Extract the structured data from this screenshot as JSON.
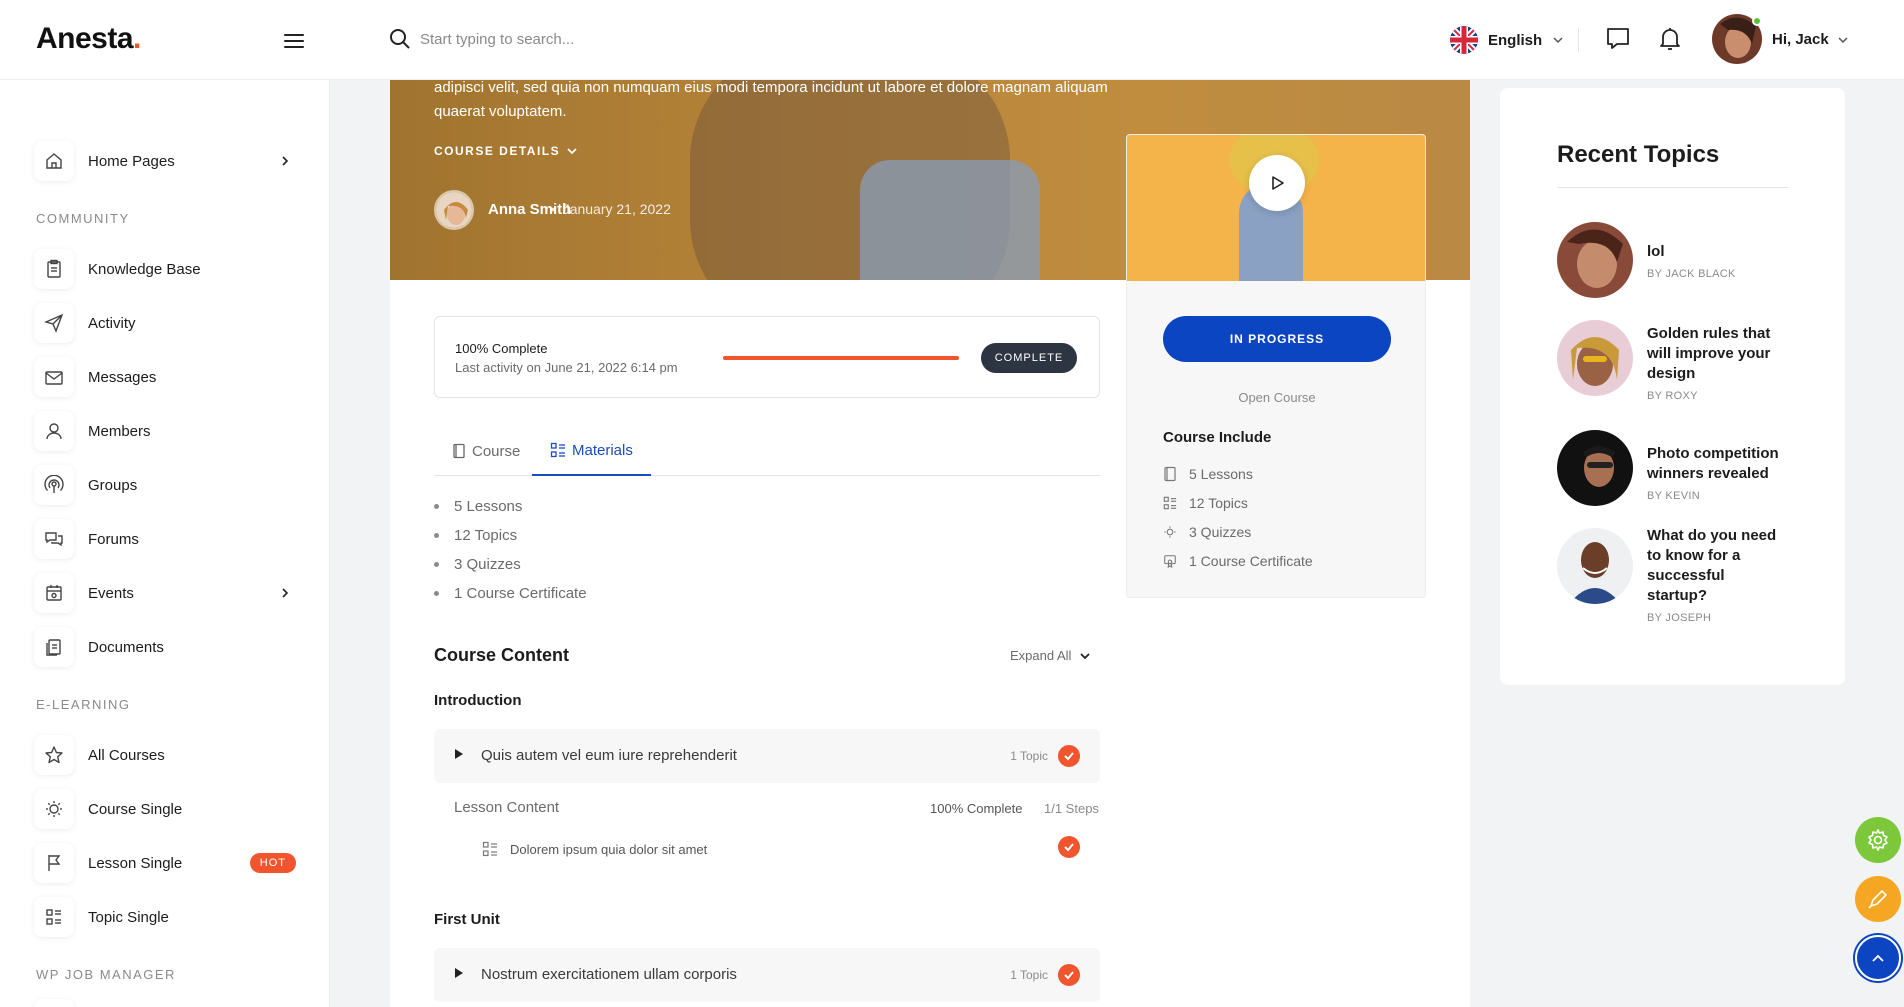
{
  "header": {
    "logo": "Anesta",
    "logo_dot": ".",
    "search_placeholder": "Start typing to search...",
    "language": "English",
    "greeting": "Hi,",
    "user_name": "Jack"
  },
  "sidebar": {
    "sections": [
      {
        "title": "COMMUNITY"
      },
      {
        "title": "E-LEARNING"
      },
      {
        "title": "WP JOB MANAGER"
      }
    ],
    "items": [
      {
        "label": "Home Pages",
        "icon": "home-icon"
      },
      {
        "label": "Knowledge Base",
        "icon": "clipboard-icon"
      },
      {
        "label": "Activity",
        "icon": "paper-plane-icon"
      },
      {
        "label": "Messages",
        "icon": "envelope-icon"
      },
      {
        "label": "Members",
        "icon": "user-icon"
      },
      {
        "label": "Groups",
        "icon": "broadcast-icon"
      },
      {
        "label": "Forums",
        "icon": "chat-bubbles-icon"
      },
      {
        "label": "Events",
        "icon": "calendar-icon"
      },
      {
        "label": "Documents",
        "icon": "documents-icon"
      },
      {
        "label": "All Courses",
        "icon": "star-icon"
      },
      {
        "label": "Course Single",
        "icon": "bulb-icon"
      },
      {
        "label": "Lesson Single",
        "icon": "flag-icon",
        "badge": "HOT"
      },
      {
        "label": "Topic Single",
        "icon": "grid-list-icon"
      }
    ]
  },
  "hero": {
    "description": "adipisci velit, sed quia non numquam eius modi tempora incidunt ut labore et dolore magnam aliquam quaerat voluptatem.",
    "course_details_label": "COURSE DETAILS",
    "author": "Anna Smith",
    "date": "January 21, 2022"
  },
  "progress": {
    "title": "100% Complete",
    "last_activity": "Last activity on June 21, 2022 6:14 pm",
    "percent": 100,
    "button": "COMPLETE"
  },
  "tabs": [
    {
      "label": "Course",
      "active": false
    },
    {
      "label": "Materials",
      "active": true
    }
  ],
  "materials": [
    "5 Lessons",
    "12 Topics",
    "3 Quizzes",
    "1 Course Certificate"
  ],
  "course_content": {
    "title": "Course Content",
    "expand_all": "Expand All",
    "units": [
      {
        "title": "Introduction",
        "lessons": [
          {
            "title": "Quis autem vel eum iure reprehenderit",
            "topics": "1 Topic",
            "content_label": "Lesson Content",
            "complete": "100% Complete",
            "steps": "1/1 Steps",
            "topic_items": [
              "Dolorem ipsum quia dolor sit amet"
            ]
          }
        ]
      },
      {
        "title": "First Unit",
        "lessons": [
          {
            "title": "Nostrum exercitationem ullam corporis",
            "topics": "1 Topic"
          }
        ]
      }
    ]
  },
  "course_panel": {
    "status_button": "IN PROGRESS",
    "open_course": "Open Course",
    "include_title": "Course Include",
    "includes": [
      {
        "label": "5 Lessons",
        "icon": "book-icon"
      },
      {
        "label": "12 Topics",
        "icon": "grid-list-icon"
      },
      {
        "label": "3 Quizzes",
        "icon": "bulb-icon"
      },
      {
        "label": "1 Course Certificate",
        "icon": "certificate-icon"
      }
    ]
  },
  "recent_topics": {
    "title": "Recent Topics",
    "items": [
      {
        "title": "lol",
        "by": "BY JACK BLACK"
      },
      {
        "title": "Golden rules that will improve your design",
        "by": "BY ROXY"
      },
      {
        "title": "Photo competition winners revealed",
        "by": "BY KEVIN"
      },
      {
        "title": "What do you need to know for a successful startup?",
        "by": "BY JOSEPH"
      }
    ]
  },
  "colors": {
    "accent": "#f2542d",
    "primary": "#0c45c2",
    "fab_green": "#7cc83a",
    "fab_orange": "#f5a623"
  }
}
